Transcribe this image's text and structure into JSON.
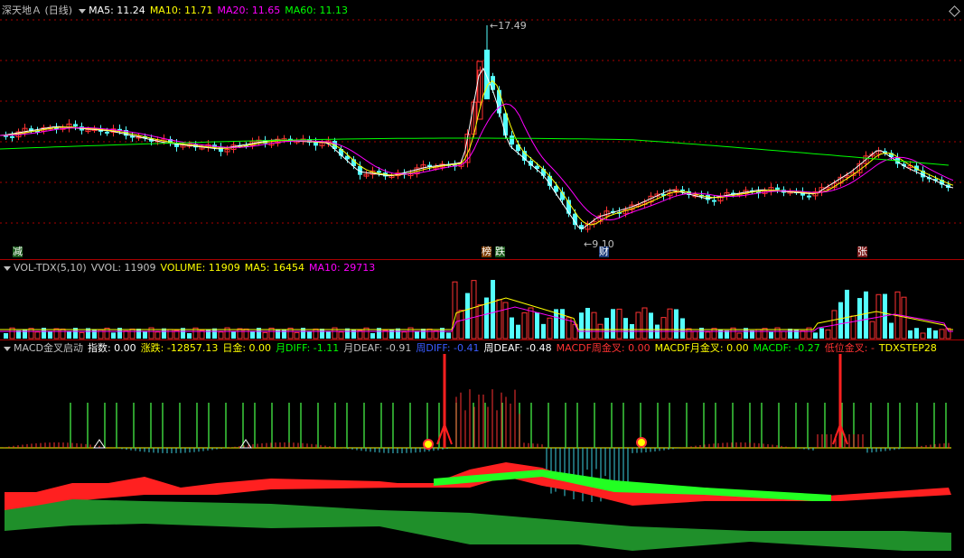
{
  "stock": {
    "name_label": "深天地Ａ (日线)",
    "ma5": "MA5: 11.24",
    "ma10": "MA10: 11.71",
    "ma20": "MA20: 11.65",
    "ma60": "MA60: 11.13",
    "high_label": "17.49",
    "low_label": "9.10"
  },
  "price_tags": {
    "jian": "减",
    "bang": "榜",
    "die": "跌",
    "cai": "财",
    "zhang": "张"
  },
  "volume": {
    "indicator": "VOL-TDX(5,10)",
    "vvol": "VVOL: 11909",
    "volume": "VOLUME: 11909",
    "ma5": "MA5: 16454",
    "ma10": "MA10: 29713"
  },
  "macd": {
    "indicator": "MACD金叉启动",
    "zhishu": "指数: 0.00",
    "zhangdie": "涨跌: -12857.13",
    "rijin": "日金: 0.00",
    "yue_diff": "月DIFF: -1.11",
    "yue_deaf": "月DEAF: -0.91",
    "zhou_diff": "周DIFF: -0.41",
    "zhou_deaf": "周DEAF: -0.48",
    "zhou_jincha": "MACDF周金叉: 0.00",
    "yue_jincha": "MACDF月金叉: 0.00",
    "macdf": "MACDF: -0.27",
    "diwei": "低位金叉: -",
    "step": "TDXSTEP28"
  },
  "colors": {
    "up": "#ff3232",
    "down": "#54ffff",
    "ma5": "#ffffff",
    "ma10": "#ffff00",
    "ma20": "#ff00ff",
    "ma60": "#00ff00",
    "grid": "#aa0000"
  }
}
